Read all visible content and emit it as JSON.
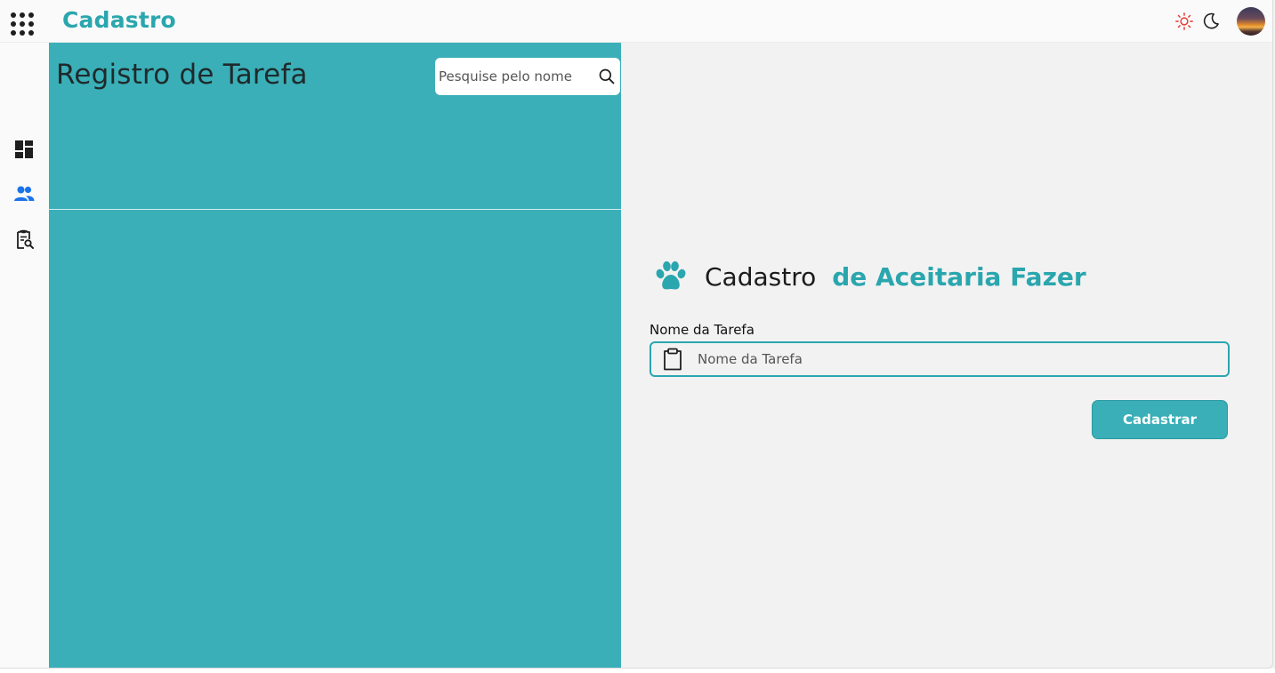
{
  "colors": {
    "accent": "#2aa6ae",
    "panel": "#3aafb8",
    "button": "#3aafb8",
    "sun_icon": "#e53935",
    "users_icon": "#1a73e8"
  },
  "header": {
    "brand": "Cadastro",
    "apps_icon": "apps-grid-icon",
    "theme_light_icon": "sun-icon",
    "theme_dark_icon": "moon-icon"
  },
  "sidebar": {
    "items": [
      {
        "icon": "dashboard-icon"
      },
      {
        "icon": "users-icon"
      },
      {
        "icon": "clipboard-search-icon"
      }
    ]
  },
  "list_panel": {
    "title": "Registro de Tarefa",
    "search_placeholder": "Pesquise pelo nome"
  },
  "form": {
    "heading_main": "Cadastro",
    "heading_accent": "de Aceitaria Fazer",
    "field_label": "Nome da Tarefa",
    "field_placeholder": "Nome da Tarefa",
    "submit_label": "Cadastrar"
  }
}
